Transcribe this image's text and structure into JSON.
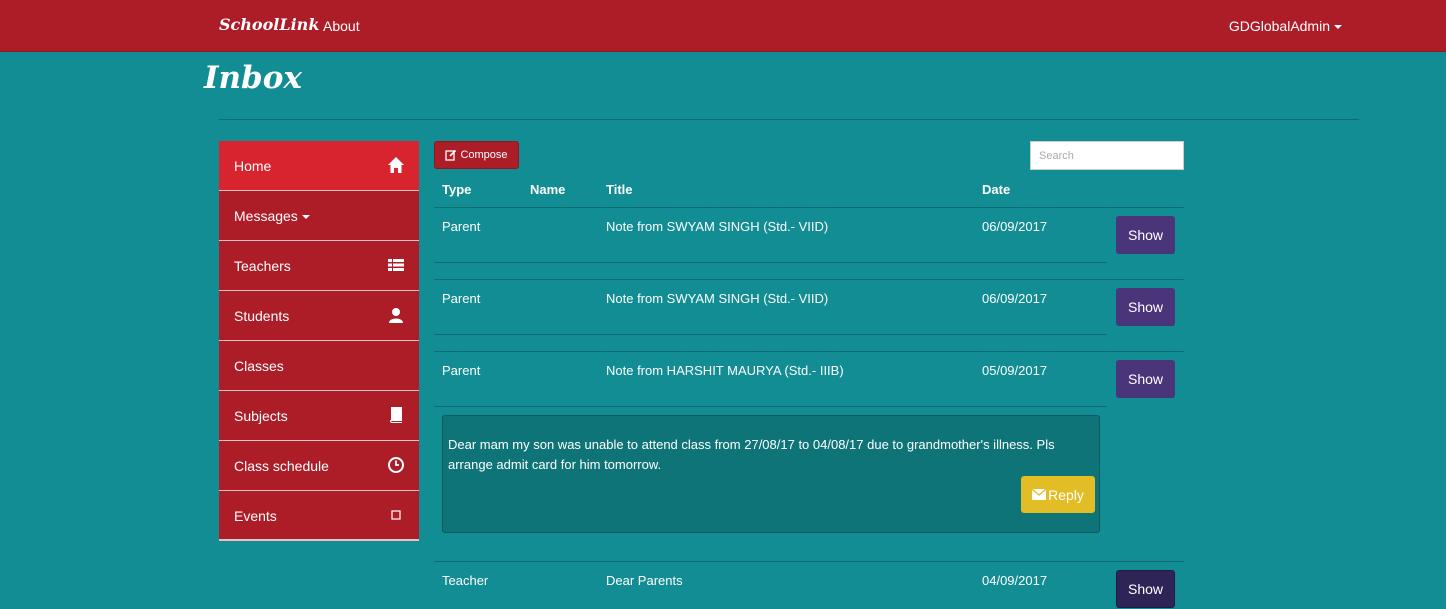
{
  "navbar": {
    "brand": "SchoolLink",
    "about": "About",
    "user": "GDGlobalAdmin"
  },
  "page": {
    "title": "Inbox"
  },
  "sidebar": {
    "items": [
      {
        "label": "Home",
        "icon": "home-icon"
      },
      {
        "label": "Messages",
        "icon": "caret-down-icon"
      },
      {
        "label": "Teachers",
        "icon": "list-icon"
      },
      {
        "label": "Students",
        "icon": "user-icon"
      },
      {
        "label": "Classes",
        "icon": ""
      },
      {
        "label": "Subjects",
        "icon": "book-icon"
      },
      {
        "label": "Class schedule",
        "icon": "clock-icon"
      },
      {
        "label": "Events",
        "icon": "calendar-icon"
      }
    ]
  },
  "toolbar": {
    "compose_label": "Compose",
    "search_placeholder": "Search"
  },
  "table": {
    "columns": [
      "Type",
      "Name",
      "Title",
      "Date"
    ],
    "rows": [
      {
        "type": "Parent",
        "name": "",
        "title": "Note from SWYAM SINGH (Std.- VIID)",
        "date": "06/09/2017",
        "action": "Show"
      },
      {
        "type": "Parent",
        "name": "",
        "title": "Note from SWYAM SINGH (Std.- VIID)",
        "date": "06/09/2017",
        "action": "Show"
      },
      {
        "type": "Parent",
        "name": "",
        "title": "Note from HARSHIT MAURYA (Std.- IIIB)",
        "date": "05/09/2017",
        "action": "Show"
      },
      {
        "type": "Teacher",
        "name": "",
        "title": "Dear Parents",
        "date": "04/09/2017",
        "action": "Show"
      }
    ]
  },
  "message": {
    "body": "Dear mam my son was unable to attend class from 27/08/17 to 04/08/17 due to grandmother's illness. Pls arrange admit card for him tomorrow.",
    "reply_label": "Reply"
  },
  "colors": {
    "background": "#128d93",
    "navbar": "#ac1d28",
    "sidebar_active": "#d8242f",
    "show_button": "#4a347a",
    "reply_button": "#e2bd25"
  }
}
